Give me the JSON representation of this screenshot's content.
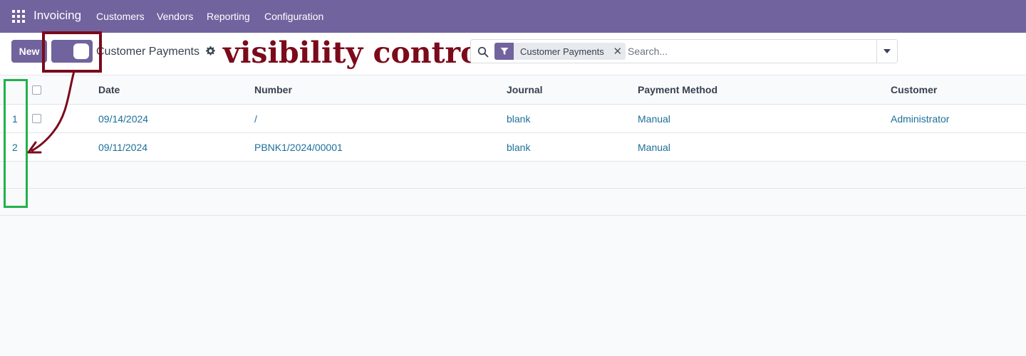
{
  "topnav": {
    "app_name": "Invoicing",
    "menu": [
      "Customers",
      "Vendors",
      "Reporting",
      "Configuration"
    ]
  },
  "controlbar": {
    "new_label": "New",
    "breadcrumb": "Customer Payments"
  },
  "annotation": {
    "label": "visibility control"
  },
  "search": {
    "facet_label": "Customer Payments",
    "placeholder": "Search..."
  },
  "table": {
    "columns": [
      "Date",
      "Number",
      "Journal",
      "Payment Method",
      "Customer"
    ],
    "rows": [
      {
        "num": "1",
        "date": "09/14/2024",
        "number": "/",
        "journal": "blank",
        "method": "Manual",
        "customer": "Administrator"
      },
      {
        "num": "2",
        "date": "09/11/2024",
        "number": "PBNK1/2024/00001",
        "journal": "blank",
        "method": "Manual",
        "customer": ""
      }
    ]
  },
  "colors": {
    "brand": "#71639e",
    "annotation_red": "#7b0a1b",
    "annotation_green": "#22b14c",
    "link": "#1d6f9a"
  }
}
